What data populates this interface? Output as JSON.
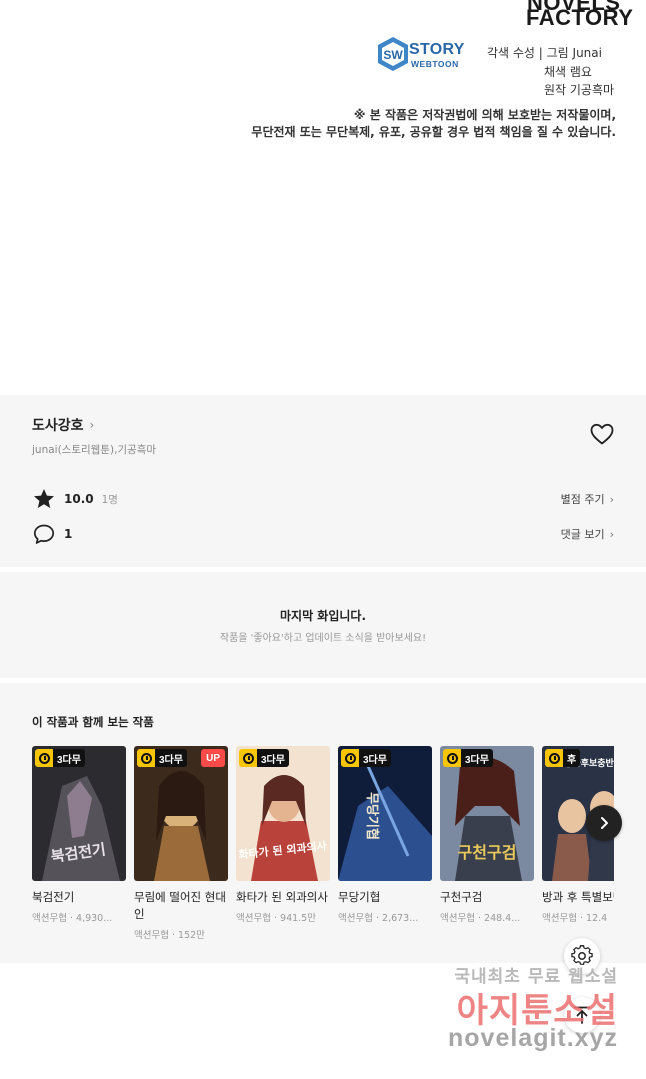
{
  "credits": {
    "publisher_top": "NOVELS",
    "publisher": "FACTORY",
    "story_logo_word": "STORY",
    "story_logo_sub": "WEBTOON",
    "lines": [
      "각색 수성 | 그림 Junai",
      "채색 램요",
      "원작 기공흑마"
    ],
    "notice_lines": [
      "※ 본 작품은 저작권법에 의해 보호받는 저작물이며,",
      "무단전재 또는 무단복제, 유포, 공유할 경우 법적 책임을 질 수 있습니다."
    ]
  },
  "info": {
    "title": "도사강호",
    "authors": "junai(스토리웹툰),기공흑마",
    "rating": "10.0",
    "rating_count": "1명",
    "rate_link": "별점 주기",
    "comment_count": "1",
    "comment_link": "댓글 보기"
  },
  "last_chapter": {
    "title": "마지막 화입니다.",
    "subtitle": "작품을 '좋아요'하고 업데이트 소식을 받아보세요!"
  },
  "recommendations": {
    "heading": "이 작품과 함께 보는 작품",
    "items": [
      {
        "title": "북검전기",
        "meta": "액션무협 · 4,930...",
        "badge": "3다무",
        "up": "",
        "cover_text": "북검전기",
        "colors": [
          "#2b2b30",
          "#55525a",
          "#8d7d8f"
        ]
      },
      {
        "title": "무림에 떨어진 현대인",
        "meta": "액션무협 · 152만",
        "badge": "3다무",
        "up": "UP",
        "cover_text": "",
        "colors": [
          "#3c2a1c",
          "#9b6b3a",
          "#d9b27a"
        ]
      },
      {
        "title": "화타가 된 외과의사",
        "meta": "액션무협 · 941.5만",
        "badge": "3다무",
        "up": "",
        "cover_text": "화타가 된 외과의사",
        "colors": [
          "#b9423a",
          "#e3b48f",
          "#f3e2cf"
        ]
      },
      {
        "title": "무당기협",
        "meta": "액션무협 · 2,673...",
        "badge": "3다무",
        "up": "",
        "cover_text": "무당기협",
        "colors": [
          "#0f1d3a",
          "#2c4f8f",
          "#79a6e0"
        ]
      },
      {
        "title": "구천구검",
        "meta": "액션무협 · 248.4...",
        "badge": "3다무",
        "up": "",
        "cover_text": "구천구검",
        "colors": [
          "#4a1f1a",
          "#7b8aa0",
          "#d8c7a6"
        ]
      },
      {
        "title": "방과 후 특별보반",
        "meta": "액션무협 · 12.4",
        "badge": "후",
        "up": "",
        "cover_text": "방과후보충반",
        "colors": [
          "#2a3346",
          "#8a5a4a",
          "#e9c4a0"
        ]
      }
    ]
  },
  "watermark": {
    "line1": "국내최초 무료 웹소설",
    "line2": "아지툰소설",
    "line3": "novelagit.xyz"
  },
  "icons": {
    "heart": "heart-outline-icon",
    "star": "star-icon",
    "comment": "speech-bubble-icon",
    "next": "chevron-right-icon",
    "settings": "gear-icon",
    "top": "arrow-up-icon"
  }
}
